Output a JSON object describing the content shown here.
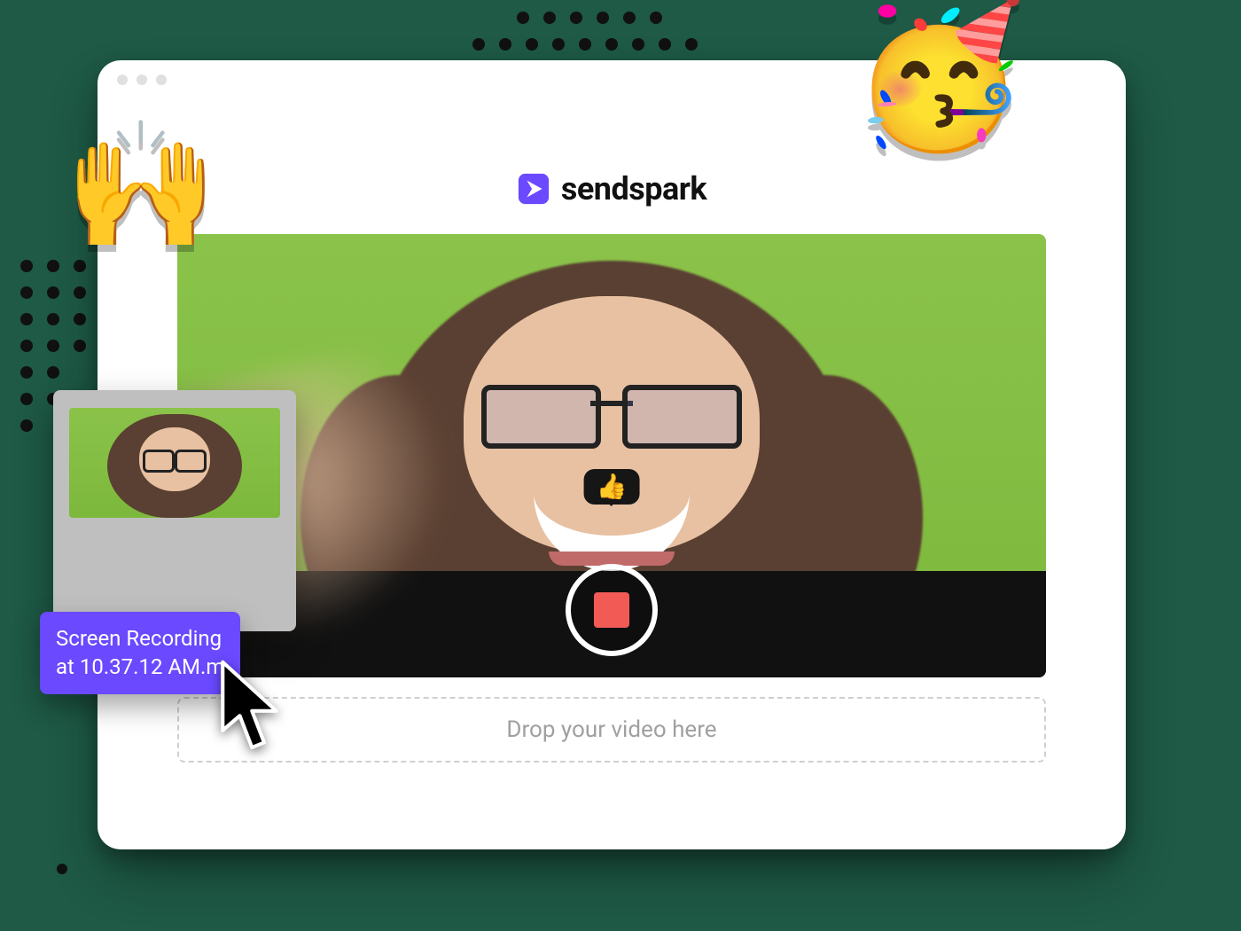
{
  "brand": {
    "name": "sendspark"
  },
  "emoji": {
    "hands": "🙌",
    "party": "🥳",
    "thumbs": "👍"
  },
  "dropzone": {
    "text": "Drop your video here"
  },
  "dragged_file": {
    "label_line1": "Screen Recording",
    "label_line2": "at 10.37.12 AM.m"
  },
  "colors": {
    "accent": "#6a49ff"
  }
}
